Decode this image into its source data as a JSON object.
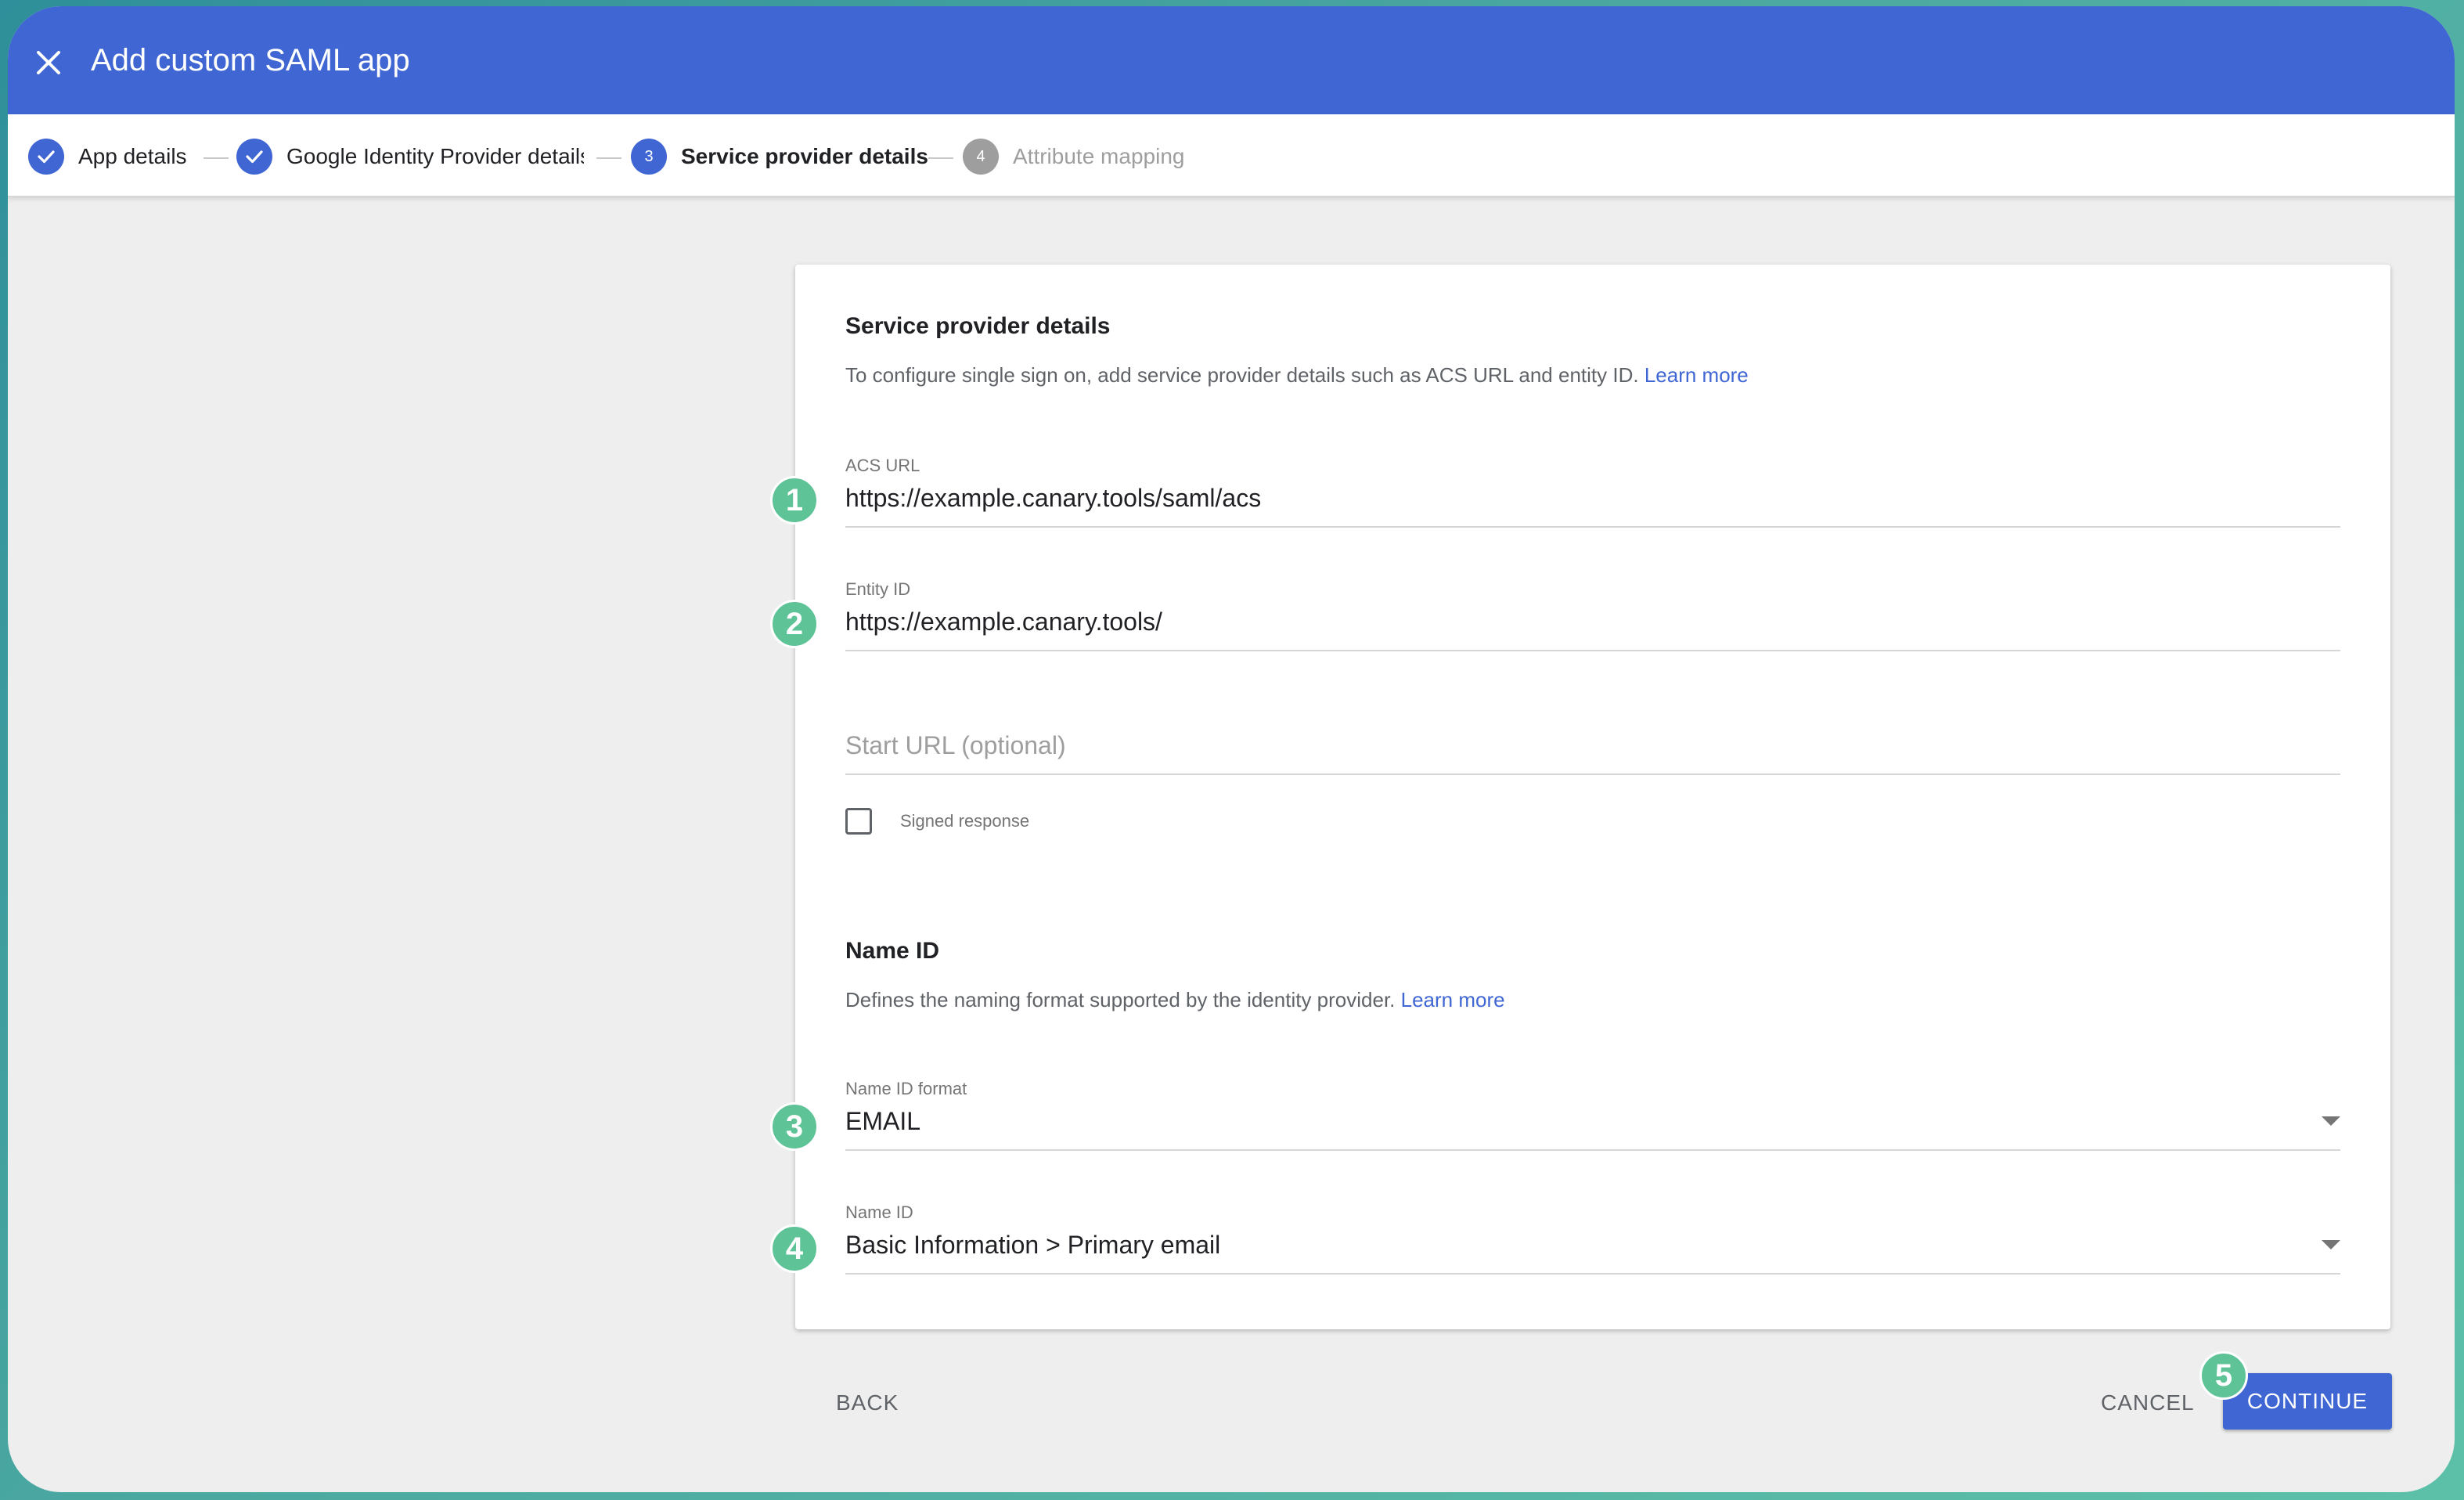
{
  "header": {
    "title": "Add custom SAML app",
    "close_icon": "close-icon"
  },
  "stepper": {
    "steps": [
      {
        "number": "1",
        "label": "App details",
        "state": "done"
      },
      {
        "number": "2",
        "label": "Google Identity Provider details",
        "state": "done"
      },
      {
        "number": "3",
        "label": "Service provider details",
        "state": "active"
      },
      {
        "number": "4",
        "label": "Attribute mapping",
        "state": "todo"
      }
    ]
  },
  "service_provider": {
    "title": "Service provider details",
    "description": "To configure single sign on, add service provider details such as ACS URL and entity ID.",
    "learn_more": "Learn more",
    "acs_url": {
      "label": "ACS URL",
      "value": "https://example.canary.tools/saml/acs"
    },
    "entity_id": {
      "label": "Entity ID",
      "value": "https://example.canary.tools/"
    },
    "start_url": {
      "placeholder": "Start URL (optional)",
      "value": ""
    },
    "signed_response": {
      "label": "Signed response",
      "checked": false
    }
  },
  "name_id": {
    "title": "Name ID",
    "description": "Defines the naming format supported by the identity provider.",
    "learn_more": "Learn more",
    "format": {
      "label": "Name ID format",
      "value": "EMAIL"
    },
    "name_id": {
      "label": "Name ID",
      "value": "Basic Information > Primary email"
    }
  },
  "footer": {
    "back": "BACK",
    "cancel": "CANCEL",
    "continue": "CONTINUE"
  },
  "badges": [
    "1",
    "2",
    "3",
    "4",
    "5"
  ],
  "colors": {
    "brand": "#3f66d3",
    "badge": "#5ec397",
    "inactive_step": "#9e9e9e"
  }
}
